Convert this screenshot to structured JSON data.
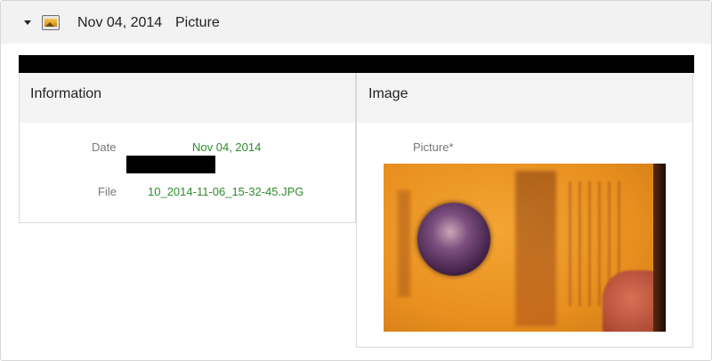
{
  "header": {
    "date": "Nov 04, 2014",
    "type": "Picture",
    "icon": "image-icon",
    "toggle_icon": "caret-down-icon"
  },
  "information": {
    "title": "Information",
    "fields": [
      {
        "label": "Date",
        "value": "Nov 04, 2014"
      },
      {
        "label": "File",
        "value": "10_2014-11-06_15-32-45.JPG"
      }
    ]
  },
  "image_panel": {
    "title": "Image",
    "picture_label": "Picture*"
  },
  "colors": {
    "value_green": "#2e8b2e",
    "label_gray": "#777777",
    "header_bg": "#f2f2f2"
  }
}
